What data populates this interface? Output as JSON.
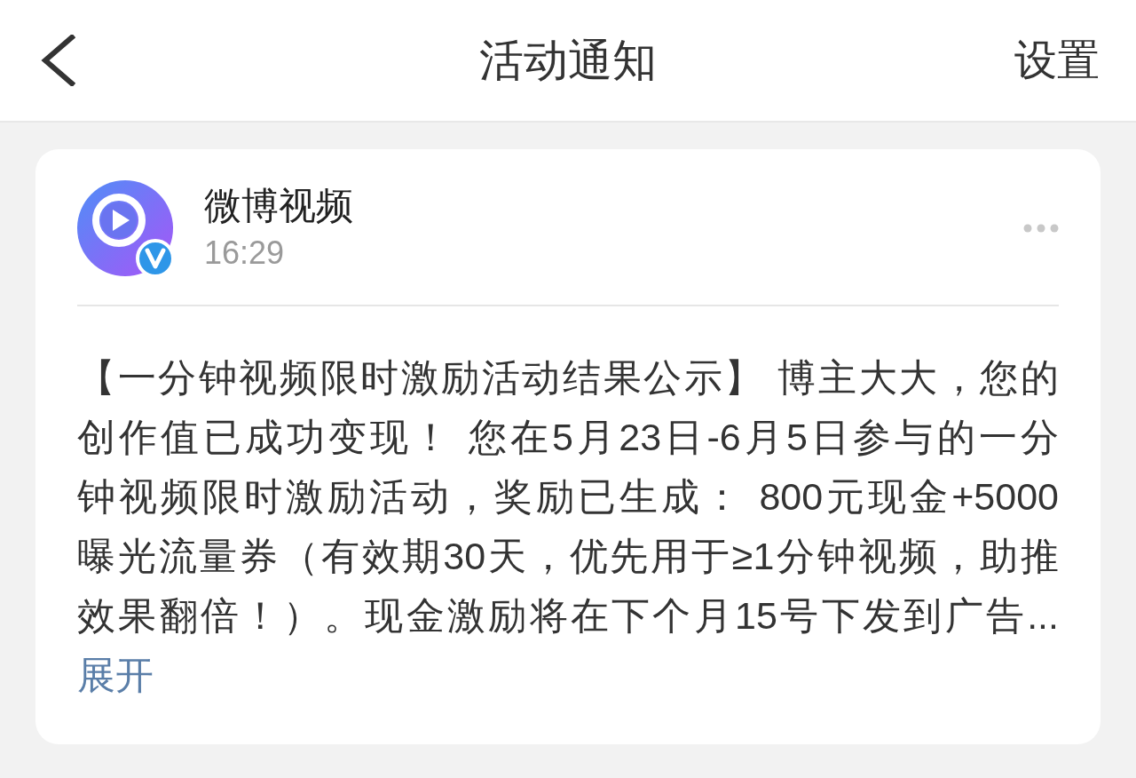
{
  "header": {
    "title": "活动通知",
    "action": "设置"
  },
  "notification": {
    "sender": "微博视频",
    "verified": true,
    "time": "16:29",
    "body_lines": [
      "【一分钟视频限时激励活动结果公示】 博主大大，您的",
      "创作值已成功变现！ 您在5月23日-6月5日参与的一分",
      "钟视频限时激励活动，奖励已生成： 800元现金+5000",
      "曝光流量券（有效期30天，优先用于≥1分钟视频，助推",
      "效果翻倍！）。现金激励将在下个月15号下发到广告..."
    ],
    "expand_link": "展开"
  }
}
